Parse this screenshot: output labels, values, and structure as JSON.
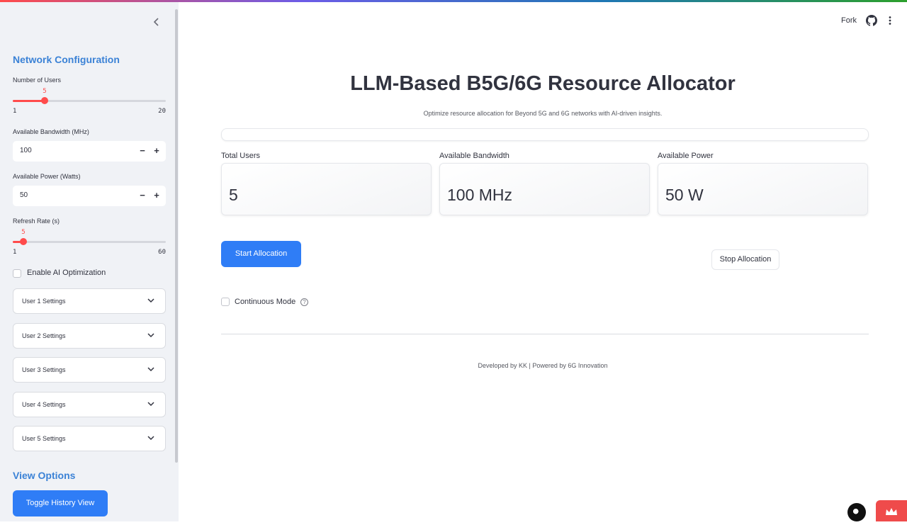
{
  "sidebar": {
    "collapse_icon": "chevron-left-icon",
    "network_header": "Network Configuration",
    "num_users": {
      "label": "Number of Users",
      "value": "5",
      "min": "1",
      "max": "20",
      "fraction": 0.2105
    },
    "bandwidth": {
      "label": "Available Bandwidth (MHz)",
      "value": "100",
      "minus": "−",
      "plus": "+"
    },
    "power": {
      "label": "Available Power (Watts)",
      "value": "50",
      "minus": "−",
      "plus": "+"
    },
    "refresh": {
      "label": "Refresh Rate (s)",
      "value": "5",
      "min": "1",
      "max": "60",
      "fraction": 0.0678
    },
    "ai_opt_label": "Enable AI Optimization",
    "user_settings": [
      "User 1 Settings",
      "User 2 Settings",
      "User 3 Settings",
      "User 4 Settings",
      "User 5 Settings"
    ],
    "view_header": "View Options",
    "toggle_history": "Toggle History View"
  },
  "toolbar": {
    "fork_label": "Fork",
    "github_icon": "github-icon",
    "menu_icon": "kebab-menu-icon"
  },
  "main": {
    "title": "LLM-Based B5G/6G Resource Allocator",
    "subtitle": "Optimize resource allocation for Beyond 5G and 6G networks with AI-driven insights.",
    "metrics": [
      {
        "label": "Total Users",
        "value": "5"
      },
      {
        "label": "Available Bandwidth",
        "value": "100 MHz"
      },
      {
        "label": "Available Power",
        "value": "50 W"
      }
    ],
    "start_button": "Start Allocation",
    "stop_button": "Stop Allocation",
    "continuous_label": "Continuous Mode",
    "help_icon": "question-circle-icon",
    "footer": "Developed by KK | Powered by 6G Innovation"
  },
  "colors": {
    "accent": "#ff4b4b",
    "primary_button": "#2f7df6",
    "sidebar_header": "#3b82d6",
    "sidebar_bg": "#f0f2f6"
  }
}
